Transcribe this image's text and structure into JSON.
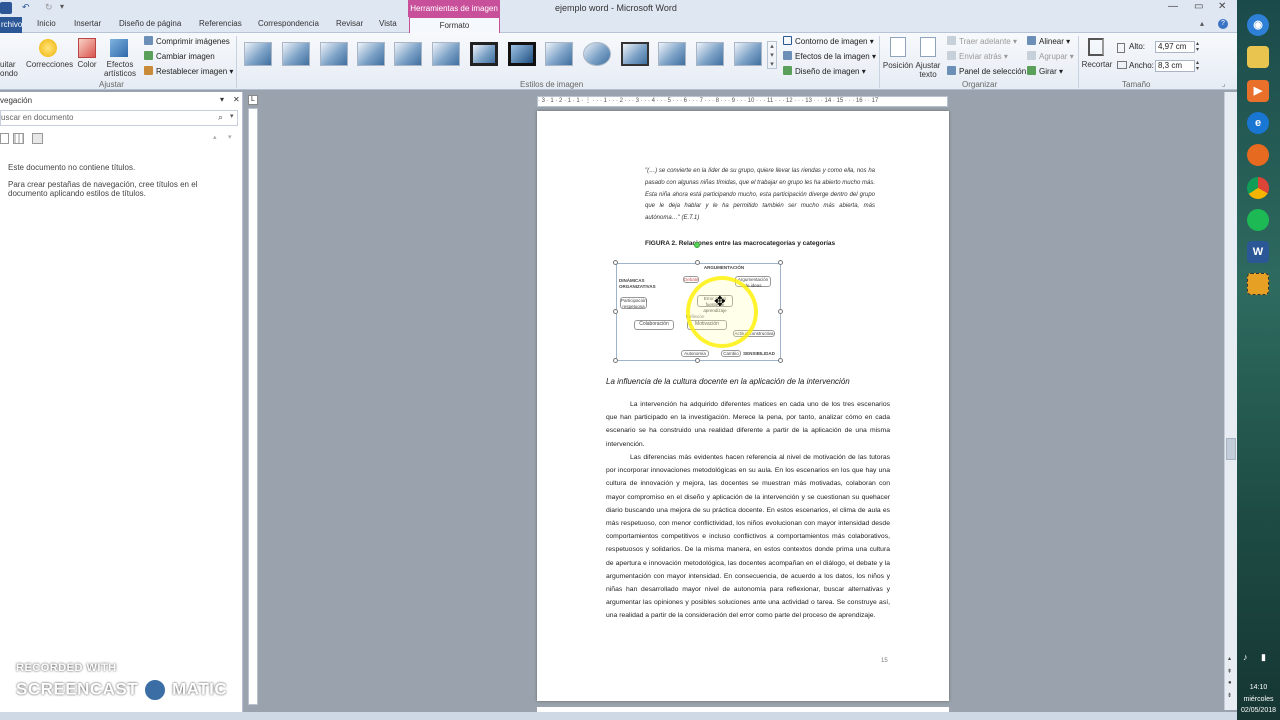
{
  "titlebar": {
    "context_tab": "Herramientas de imagen",
    "title": "ejemplo word - Microsoft Word"
  },
  "tabs": [
    "rchivo",
    "Inicio",
    "Insertar",
    "Diseño de página",
    "Referencias",
    "Correspondencia",
    "Revisar",
    "Vista",
    "Formato"
  ],
  "ribbon": {
    "adjust": {
      "quitar_fondo": "uitar\nondo",
      "corrections": "Correcciones",
      "color": "Color",
      "effects": "Efectos\nartísticos",
      "compress": "Comprimir imágenes",
      "change": "Cambiar imagen",
      "reset": "Restablecer imagen",
      "group": "Ajustar"
    },
    "styles": {
      "group": "Estilos de imagen",
      "border": "Contorno de imagen",
      "effects": "Efectos de la imagen",
      "layout": "Diseño de imagen"
    },
    "arrange": {
      "position": "Posición",
      "wrap": "Ajustar\ntexto",
      "bring_forward": "Traer adelante",
      "send_backward": "Enviar atrás",
      "selection_pane": "Panel de selección",
      "align": "Alinear",
      "group_btn": "Agrupar",
      "rotate": "Girar",
      "group": "Organizar"
    },
    "size": {
      "crop": "Recortar",
      "height_label": "Alto:",
      "height_value": "4,97 cm",
      "width_label": "Ancho:",
      "width_value": "8,3 cm",
      "group": "Tamaño"
    }
  },
  "nav": {
    "title": "vegación",
    "search_placeholder": "uscar en documento",
    "empty_line1": "Este documento no contiene títulos.",
    "empty_line2": "Para crear pestañas de navegación, cree títulos en el documento aplicando estilos de títulos."
  },
  "ruler": "· 3 · 1 · 2 · 1 · 1 · ⋮ · · · 1 · · · 2 · · · 3 · · · 4 · · · 5 · · · 6 · · · 7 · · · 8 · · · 9 · · · 10 · · · 11 · · · 12 · · · 13 · · · 14 · 15 · · · 16 · · 17",
  "document": {
    "quote": "\"(…) se convierte en la líder de su grupo, quiere llevar las riendas y como ella, nos ha pasado con algunas niñas tímidas, que el trabajar en grupo les ha abierto mucho más. Esta niña ahora está participando mucho, esta participación diverge dentro del grupo que le deja hablar y le ha permitido también ser mucho más abierta, más autónoma…\" (E.T.1)",
    "figure_caption": "FIGURA 2. Relaciones entre las macrocategorías y categorías",
    "figure": {
      "argumentacion": "ARGUMENTACIÓN",
      "dinamicas": "DINÁMICAS ORGANIZATIVAS",
      "sensibilidad": "SENSIBILIDAD",
      "colaboracion": "Colaboración",
      "motivacion": "Motivación",
      "autonomia": "Autonomía",
      "cambio": "Cambio",
      "aprendizaje": "Participación respetuosa",
      "debate": "Debate",
      "conocimiento": "Argumentación de ideas",
      "reflexion": "Reflexión",
      "error": "Actitud constructiva",
      "centro": "Error como fuente de aprendizaje"
    },
    "heading": "La influencia de la cultura docente en la aplicación de la intervención",
    "para1": "La intervención ha adquirido diferentes matices en cada uno de los tres escenarios que han participado en la investigación. Merece la pena, por tanto, analizar cómo en cada escenario se ha construido una realidad diferente a partir de la aplicación de una misma intervención.",
    "para2": "Las diferencias más evidentes hacen referencia al nivel de motivación de las tutoras por incorporar innovaciones metodológicas en su aula. En los escenarios en los que hay una cultura de innovación y mejora, las docentes se muestran más motivadas, colaboran con mayor compromiso en el diseño y aplicación de la intervención y se cuestionan su quehacer diario buscando una mejora de su práctica docente. En estos escenarios, el clima de aula es más respetuoso, con menor conflictividad, los niños evolucionan con mayor intensidad desde comportamientos competitivos e incluso conflictivos a comportamientos más colaborativos, respetuosos y solidarios. De la misma manera, en estos contextos donde prima una cultura de apertura e innovación metodológica, las docentes acompañan en el diálogo, el debate y la argumentación con mayor intensidad. En consecuencia, de acuerdo a los datos, los niños y niñas han desarrollado mayor nivel de autonomía para reflexionar, buscar alternativas y argumentar las opiniones y posibles soluciones ante una actividad o tarea. Se construye así, una realidad a partir de la consideración del error como parte del proceso de aprendizaje.",
    "page_number": "15"
  },
  "taskbar": {
    "time": "14:10",
    "day": "miércoles",
    "date": "02/05/2018"
  },
  "watermark": {
    "top": "RECORDED WITH",
    "left": "SCREENCAST",
    "right": "MATIC"
  },
  "colors": {
    "context_tab": "#c8509a",
    "file_tab": "#2b5797",
    "highlight": "#fff000"
  }
}
